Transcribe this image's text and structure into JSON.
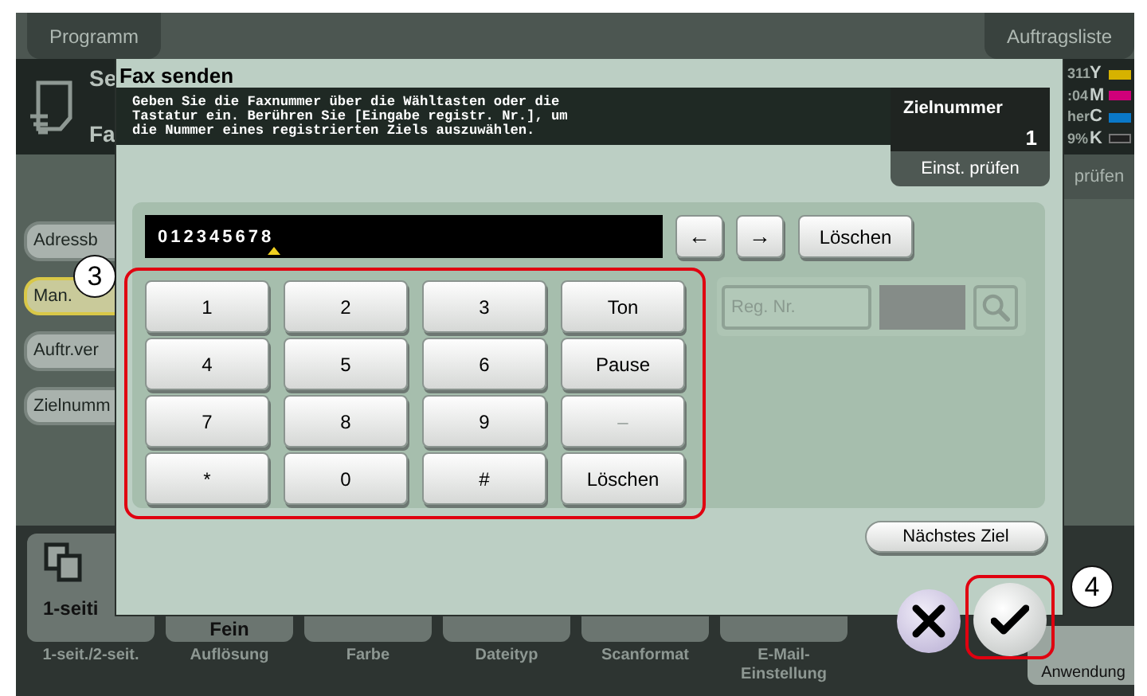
{
  "top_buttons": [
    "Programm",
    "Auftragsliste"
  ],
  "mode": {
    "line_1": "Se",
    "line_2": "Fa"
  },
  "status": {
    "rows": [
      {
        "text": "311",
        "toner": "Y",
        "color": "#d6b200"
      },
      {
        "text": ":04",
        "toner": "M",
        "color": "#d0007a"
      },
      {
        "text": "her",
        "toner": "C",
        "color": "#0a78c8"
      },
      {
        "text": "9%",
        "toner": "K",
        "color": "#202020"
      }
    ],
    "button": "prüfen"
  },
  "sidebar": {
    "items": [
      {
        "label": "Adressb",
        "selected": false
      },
      {
        "label": "Man.",
        "selected": true
      },
      {
        "label": "Auftr.ver",
        "selected": false
      },
      {
        "label": "Zielnumm",
        "selected": false
      }
    ]
  },
  "functions": [
    {
      "kind": "icon",
      "value": "1-seiti",
      "label": "1-seit./2-seit."
    },
    {
      "kind": "text",
      "value": "Fein",
      "label": "Auflösung"
    },
    {
      "kind": "empty",
      "label": "Farbe"
    },
    {
      "kind": "empty",
      "label": "Dateityp"
    },
    {
      "kind": "empty",
      "label": "Scanformat"
    },
    {
      "kind": "empty",
      "label": "E-Mail-Einstellung"
    }
  ],
  "application_button": "Anwendung",
  "dialog": {
    "title": "Fax senden",
    "instruction": [
      "Geben Sie die Faxnummer über die Wähltasten oder die",
      "Tastatur ein. Berühren Sie [Eingabe registr. Nr.], um",
      "die Nummer eines registrierten Ziels auszuwählen."
    ],
    "destination": {
      "label": "Zielnummer",
      "value": "1"
    },
    "check_button": "Einst. prüfen",
    "input": {
      "value": "012345678"
    },
    "cursor_buttons": [
      "←",
      "→"
    ],
    "clear_button": "Löschen",
    "keypad": [
      {
        "label": "1",
        "disabled": false
      },
      {
        "label": "2",
        "disabled": false
      },
      {
        "label": "3",
        "disabled": false
      },
      {
        "label": "Ton",
        "disabled": false
      },
      {
        "label": "4",
        "disabled": false
      },
      {
        "label": "5",
        "disabled": false
      },
      {
        "label": "6",
        "disabled": false
      },
      {
        "label": "Pause",
        "disabled": false
      },
      {
        "label": "7",
        "disabled": false
      },
      {
        "label": "8",
        "disabled": false
      },
      {
        "label": "9",
        "disabled": false
      },
      {
        "label": "–",
        "disabled": true
      },
      {
        "label": "*",
        "disabled": false
      },
      {
        "label": "0",
        "disabled": false
      },
      {
        "label": "#",
        "disabled": false
      },
      {
        "label": "Löschen",
        "disabled": false
      }
    ],
    "registration": {
      "placeholder": "Reg. Nr."
    },
    "next_button": "Nächstes Ziel"
  },
  "annotations": [
    {
      "label": "3"
    },
    {
      "label": "4"
    }
  ]
}
